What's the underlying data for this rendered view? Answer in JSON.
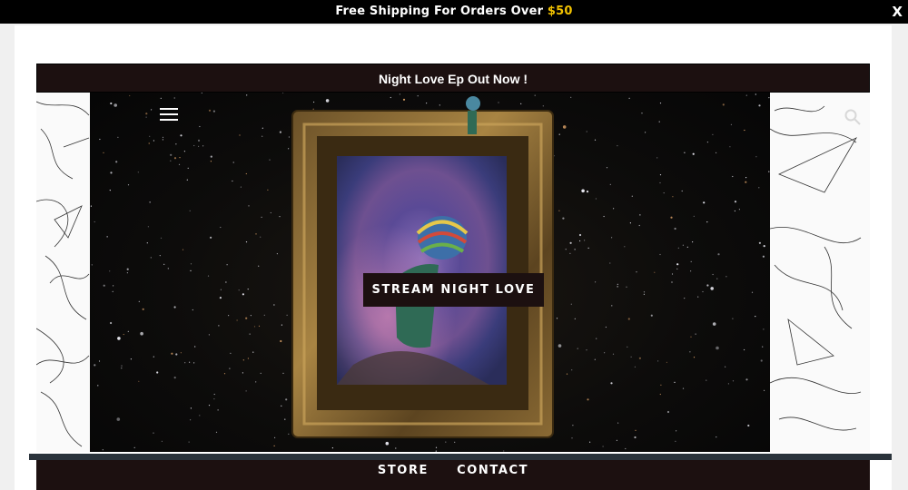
{
  "shipping_bar": {
    "text_before": "Free Shipping For Orders Over ",
    "price": "$50",
    "close_label": "X",
    "colors": {
      "background": "#000000",
      "price": "#f2c200"
    }
  },
  "announcement": {
    "text": "Night Love Ep Out Now !"
  },
  "hero": {
    "menu_icon": "hamburger-menu-icon",
    "search_icon": "search-icon",
    "cta_label": "STREAM NIGHT LOVE"
  },
  "nav": {
    "items": [
      "STORE",
      "CONTACT"
    ]
  },
  "colors": {
    "brand_dark": "#1c1010",
    "divider": "#2a333b",
    "frame_gold": "#8a6a34"
  }
}
